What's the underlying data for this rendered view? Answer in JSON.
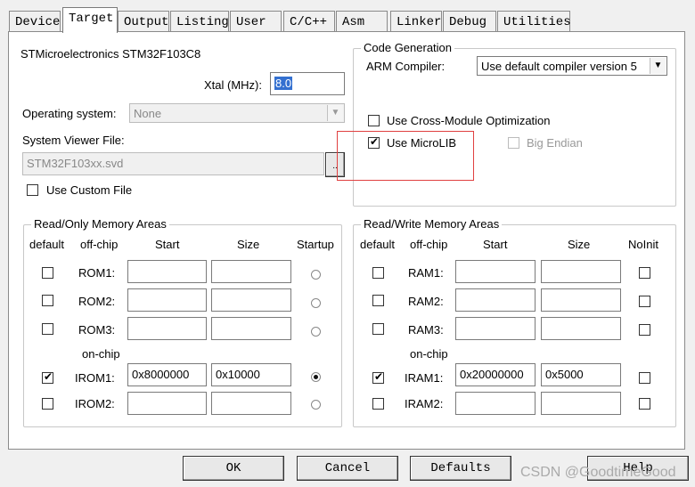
{
  "tabs": [
    "Device",
    "Target",
    "Output",
    "Listing",
    "User",
    "C/C++",
    "Asm",
    "Linker",
    "Debug",
    "Utilities"
  ],
  "active_tab": "Target",
  "device": {
    "name": "STMicroelectronics STM32F103C8",
    "xtal_label": "Xtal (MHz):",
    "xtal_value": "8.0",
    "os_label": "Operating system:",
    "os_value": "None",
    "svd_label": "System Viewer File:",
    "svd_value": "STM32F103xx.svd",
    "browse_label": "..",
    "custom_file_label": "Use Custom File",
    "custom_file_checked": false
  },
  "code_gen": {
    "title": "Code Generation",
    "compiler_label": "ARM Compiler:",
    "compiler_value": "Use default compiler version 5",
    "cross_module_label": "Use Cross-Module Optimization",
    "cross_module_checked": false,
    "microlib_label": "Use MicroLIB",
    "microlib_checked": true,
    "big_endian_label": "Big Endian",
    "big_endian_checked": false
  },
  "rom": {
    "title": "Read/Only Memory Areas",
    "headers": [
      "default",
      "off-chip",
      "Start",
      "Size",
      "Startup"
    ],
    "on_chip_label": "on-chip",
    "rows": [
      {
        "label": "ROM1:",
        "default": false,
        "start": "",
        "size": "",
        "startup": false
      },
      {
        "label": "ROM2:",
        "default": false,
        "start": "",
        "size": "",
        "startup": false
      },
      {
        "label": "ROM3:",
        "default": false,
        "start": "",
        "size": "",
        "startup": false
      },
      {
        "label": "IROM1:",
        "default": true,
        "start": "0x8000000",
        "size": "0x10000",
        "startup": true
      },
      {
        "label": "IROM2:",
        "default": false,
        "start": "",
        "size": "",
        "startup": false
      }
    ]
  },
  "ram": {
    "title": "Read/Write Memory Areas",
    "headers": [
      "default",
      "off-chip",
      "Start",
      "Size",
      "NoInit"
    ],
    "on_chip_label": "on-chip",
    "rows": [
      {
        "label": "RAM1:",
        "default": false,
        "start": "",
        "size": "",
        "noinit": false
      },
      {
        "label": "RAM2:",
        "default": false,
        "start": "",
        "size": "",
        "noinit": false
      },
      {
        "label": "RAM3:",
        "default": false,
        "start": "",
        "size": "",
        "noinit": false
      },
      {
        "label": "IRAM1:",
        "default": true,
        "start": "0x20000000",
        "size": "0x5000",
        "noinit": false
      },
      {
        "label": "IRAM2:",
        "default": false,
        "start": "",
        "size": "",
        "noinit": false
      }
    ]
  },
  "buttons": {
    "ok": "OK",
    "cancel": "Cancel",
    "defaults": "Defaults",
    "help": "Help"
  },
  "watermark": "CSDN @GoodtimeGood",
  "colors": {
    "highlight_box": "#e04040",
    "xtal_selection": "#3470d0"
  }
}
